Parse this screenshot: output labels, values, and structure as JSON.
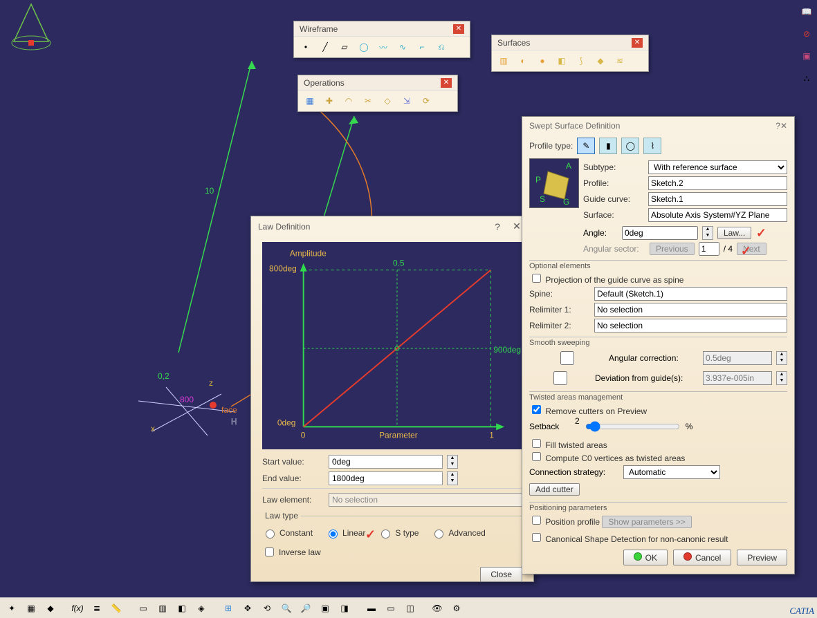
{
  "toolboxes": {
    "wireframe": {
      "title": "Wireframe",
      "icons": [
        "point",
        "line",
        "plane",
        "circle",
        "spline",
        "curve",
        "corner",
        "connect"
      ]
    },
    "surfaces": {
      "title": "Surfaces",
      "icons": [
        "extrude",
        "revolve",
        "sphere",
        "offset",
        "sweep",
        "fill",
        "loft"
      ]
    },
    "operations": {
      "title": "Operations",
      "icons": [
        "join",
        "healing",
        "split",
        "trim",
        "boundary",
        "extract",
        "transform"
      ]
    }
  },
  "law_dialog": {
    "title": "Law Definition",
    "amplitude_label": "Amplitude",
    "y_top": "800deg",
    "y_bottom": "0deg",
    "x_mid_top": "0.5",
    "x_right": "900deg",
    "x_start": "0",
    "x_end": "1",
    "x_axis": "Parameter",
    "start_label": "Start value:",
    "start_value": "0deg",
    "end_label": "End value:",
    "end_value": "1800deg",
    "law_element_label": "Law element:",
    "law_element_value": "No selection",
    "law_type_legend": "Law type",
    "radios": {
      "constant": "Constant",
      "linear": "Linear",
      "stype": "S type",
      "advanced": "Advanced"
    },
    "selected_radio": "linear",
    "inverse_label": "Inverse law",
    "close_btn": "Close"
  },
  "ssd": {
    "title": "Swept Surface Definition",
    "profile_type_label": "Profile type:",
    "subtype_label": "Subtype:",
    "subtype_value": "With reference surface",
    "profile_label": "Profile:",
    "profile_value": "Sketch.2",
    "guide_label": "Guide curve:",
    "guide_value": "Sketch.1",
    "surface_label": "Surface:",
    "surface_value": "Absolute Axis System#YZ Plane",
    "angle_label": "Angle:",
    "angle_value": "0deg",
    "law_btn": "Law...",
    "angsector_label": "Angular sector:",
    "prev_btn": "Previous",
    "sector_value": "1",
    "sector_total": "/ 4",
    "next_btn": "Next",
    "optional_group": "Optional elements",
    "projection_label": "Projection of the guide curve as spine",
    "spine_label": "Spine:",
    "spine_value": "Default (Sketch.1)",
    "relim1_label": "Relimiter 1:",
    "relim1_value": "No selection",
    "relim2_label": "Relimiter 2:",
    "relim2_value": "No selection",
    "smooth_group": "Smooth sweeping",
    "angcorr_label": "Angular correction:",
    "angcorr_value": "0.5deg",
    "dev_label": "Deviation from guide(s):",
    "dev_value": "3.937e-005in",
    "twisted_group": "Twisted areas management",
    "remove_cutters": "Remove cutters on Preview",
    "setback_label": "Setback",
    "setback_value": "2",
    "setback_pct": "%",
    "fill_twisted": "Fill twisted areas",
    "compute_c0": "Compute C0 vertices as twisted areas",
    "conn_label": "Connection strategy:",
    "conn_value": "Automatic",
    "add_cutter_btn": "Add cutter",
    "pos_group": "Positioning parameters",
    "pos_profile": "Position profile",
    "show_params": "Show parameters >>",
    "canonical": "Canonical Shape Detection for non-canonic result",
    "ok": "OK",
    "cancel": "Cancel",
    "preview": "Preview"
  },
  "viewport_labels": {
    "len10": "10",
    "len02": "0,2",
    "tag800": "800",
    "axis_z": "z",
    "axis_x": "x",
    "face": "face",
    "H": "H"
  },
  "chart_data": {
    "type": "line",
    "title": "Law Definition",
    "xlabel": "Parameter",
    "ylabel": "Amplitude",
    "x": [
      0,
      1
    ],
    "y": [
      0,
      1800
    ],
    "series": [
      {
        "name": "Linear law",
        "values": [
          [
            0,
            0
          ],
          [
            1,
            1800
          ]
        ]
      }
    ],
    "xlim": [
      0,
      1
    ],
    "ylim_display_deg": [
      0,
      800
    ],
    "annotations": {
      "x_mid": 0.5,
      "right_label_deg": 900
    }
  }
}
